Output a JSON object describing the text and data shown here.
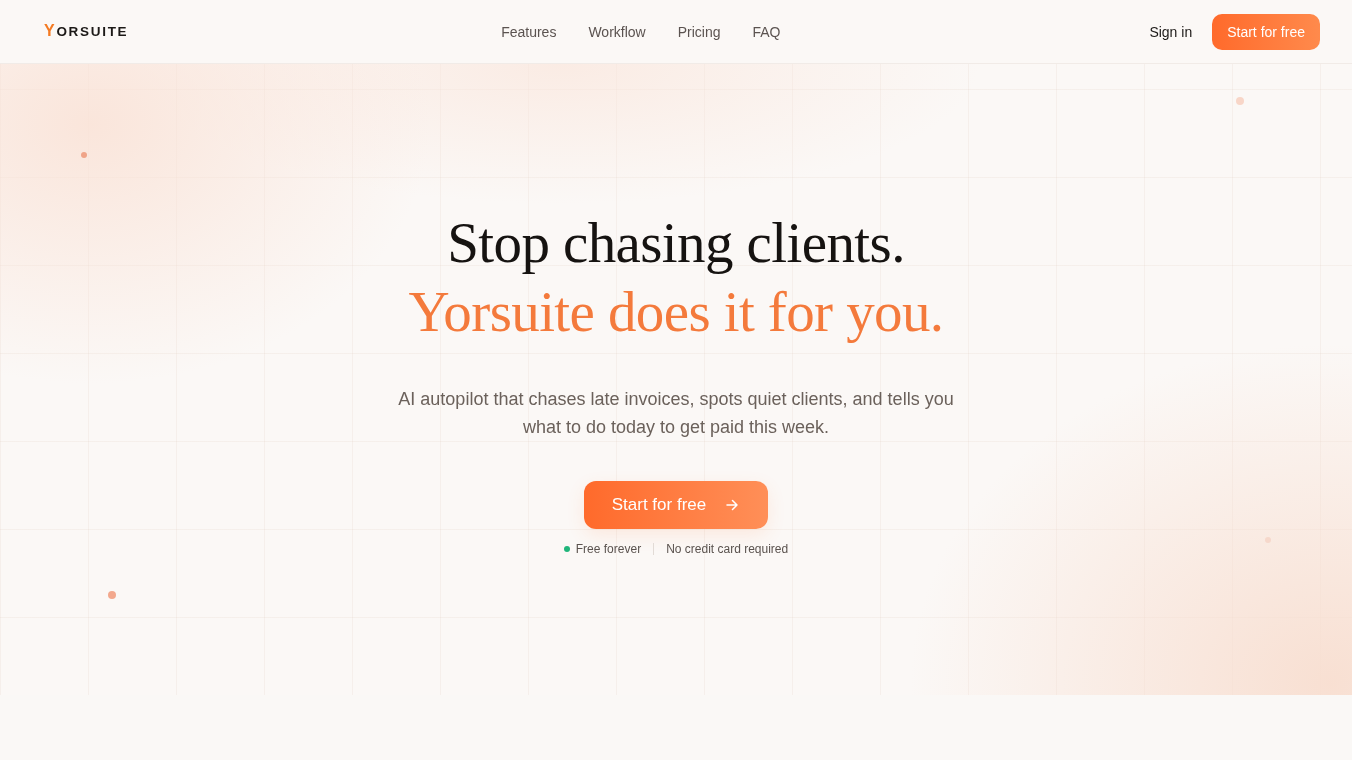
{
  "nav": {
    "logo": "YORSUITE",
    "links": [
      "Features",
      "Workflow",
      "Pricing",
      "FAQ"
    ],
    "sign_in": "Sign in",
    "cta": "Start for free"
  },
  "hero": {
    "headline": "Stop chasing clients.",
    "headline_accent": "Yorsuite does it for you.",
    "subtitle": "AI autopilot that chases late invoices, spots quiet clients, and tells you what to do today to get paid this week.",
    "cta": "Start for free",
    "notes": [
      {
        "text": "Free forever",
        "kind": "dot"
      },
      {
        "text": "No credit card required",
        "kind": "plain"
      }
    ]
  }
}
